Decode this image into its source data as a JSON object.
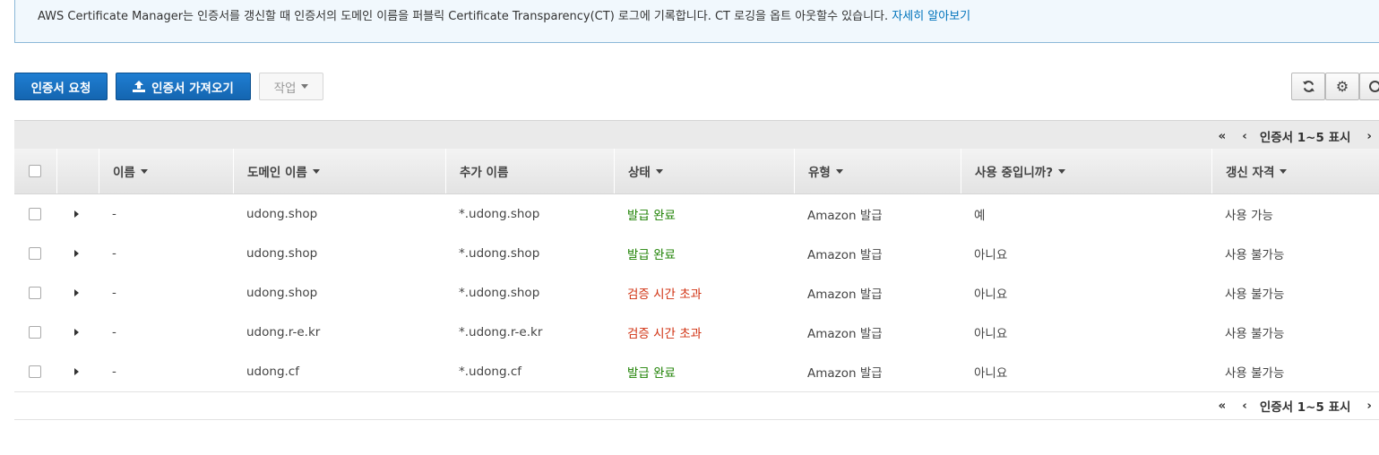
{
  "banner": {
    "text": "AWS Certificate Manager는 인증서를 갱신할 때 인증서의 도메인 이름을 퍼블릭 Certificate Transparency(CT) 로그에 기록합니다. CT 로깅을 옵트 아웃할수 있습니다.",
    "link": "자세히 알아보기"
  },
  "toolbar": {
    "request_label": "인증서 요청",
    "import_label": "인증서 가져오기",
    "actions_label": "작업"
  },
  "pager": {
    "first": "«",
    "prev": "‹",
    "text": "인증서 1~5 표시",
    "next": "›"
  },
  "columns": [
    "이름",
    "도메인 이름",
    "추가 이름",
    "상태",
    "유형",
    "사용 중입니까?",
    "갱신 자격"
  ],
  "rows": [
    {
      "name": "-",
      "domain": "udong.shop",
      "additional": "*.udong.shop",
      "status": "발급 완료",
      "status_ok": true,
      "type": "Amazon 발급",
      "in_use": "예",
      "renewal": "사용 가능"
    },
    {
      "name": "-",
      "domain": "udong.shop",
      "additional": "*.udong.shop",
      "status": "발급 완료",
      "status_ok": true,
      "type": "Amazon 발급",
      "in_use": "아니요",
      "renewal": "사용 불가능"
    },
    {
      "name": "-",
      "domain": "udong.shop",
      "additional": "*.udong.shop",
      "status": "검증 시간 초과",
      "status_ok": false,
      "type": "Amazon 발급",
      "in_use": "아니요",
      "renewal": "사용 불가능"
    },
    {
      "name": "-",
      "domain": "udong.r-e.kr",
      "additional": "*.udong.r-e.kr",
      "status": "검증 시간 초과",
      "status_ok": false,
      "type": "Amazon 발급",
      "in_use": "아니요",
      "renewal": "사용 불가능"
    },
    {
      "name": "-",
      "domain": "udong.cf",
      "additional": "*.udong.cf",
      "status": "발급 완료",
      "status_ok": true,
      "type": "Amazon 발급",
      "in_use": "아니요",
      "renewal": "사용 불가능"
    }
  ],
  "colors": {
    "primary": "#1465b0",
    "success": "#1d8102",
    "error": "#d13212",
    "link": "#0073bb"
  },
  "icons": {
    "import": "upload-icon",
    "refresh": "refresh-icon",
    "settings": "gear-icon",
    "help": "help-icon"
  }
}
